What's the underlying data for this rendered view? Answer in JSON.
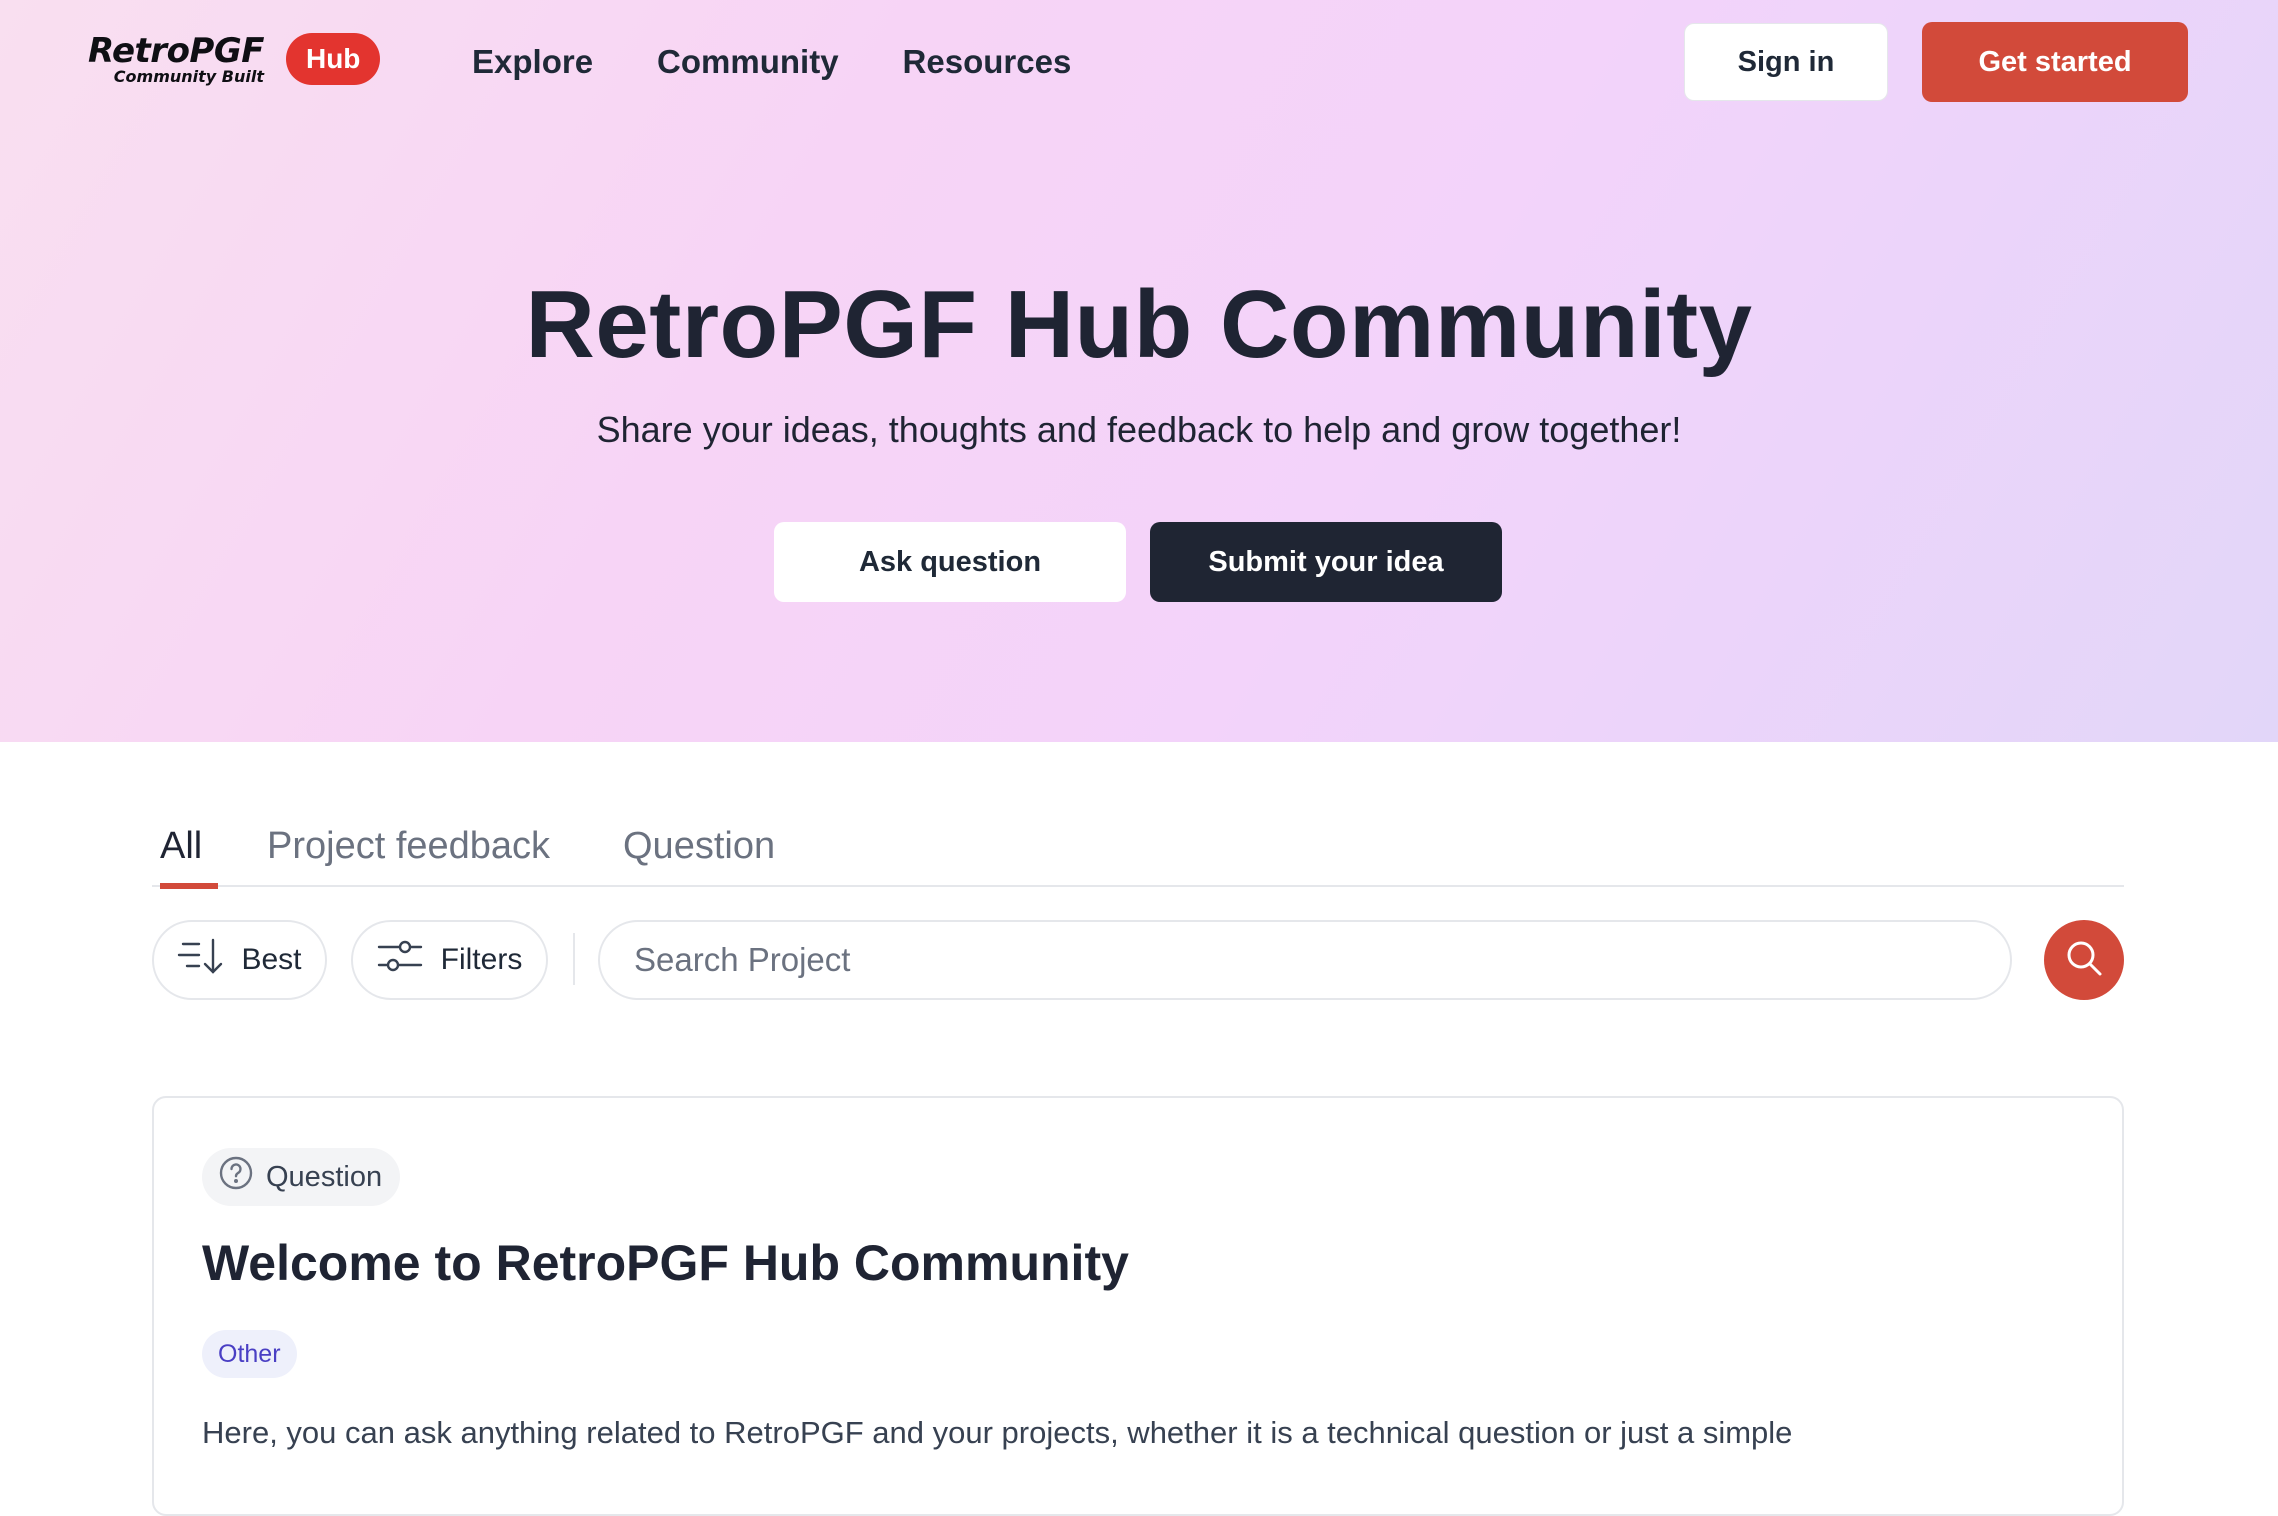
{
  "brand": {
    "logo_main": "RetroPGF",
    "logo_sub": "Community Built",
    "badge": "Hub"
  },
  "nav": {
    "links": [
      "Explore",
      "Community",
      "Resources"
    ],
    "sign_in": "Sign in",
    "get_started": "Get started"
  },
  "hero": {
    "title": "RetroPGF Hub Community",
    "subtitle": "Share your ideas, thoughts and feedback to help and grow together!",
    "ask_question": "Ask question",
    "submit_idea": "Submit your idea"
  },
  "tabs": [
    "All",
    "Project feedback",
    "Question"
  ],
  "active_tab": "All",
  "toolbar": {
    "sort_label": "Best",
    "filters_label": "Filters",
    "search_placeholder": "Search Project",
    "search_value": ""
  },
  "post": {
    "type": "Question",
    "title": "Welcome to RetroPGF Hub Community",
    "tag": "Other",
    "body": "Here, you can ask anything related to RetroPGF and your projects, whether it is a technical question or just a simple"
  },
  "colors": {
    "accent": "#d24a3a",
    "badge_red": "#e3342f",
    "dark_button": "#1f2533",
    "tag_text": "#4a3fc4",
    "tag_bg": "#eef0fb"
  },
  "icons": {
    "sort": "sort-descending-icon",
    "filters": "sliders-icon",
    "search": "search-icon",
    "question": "question-circle-icon"
  }
}
